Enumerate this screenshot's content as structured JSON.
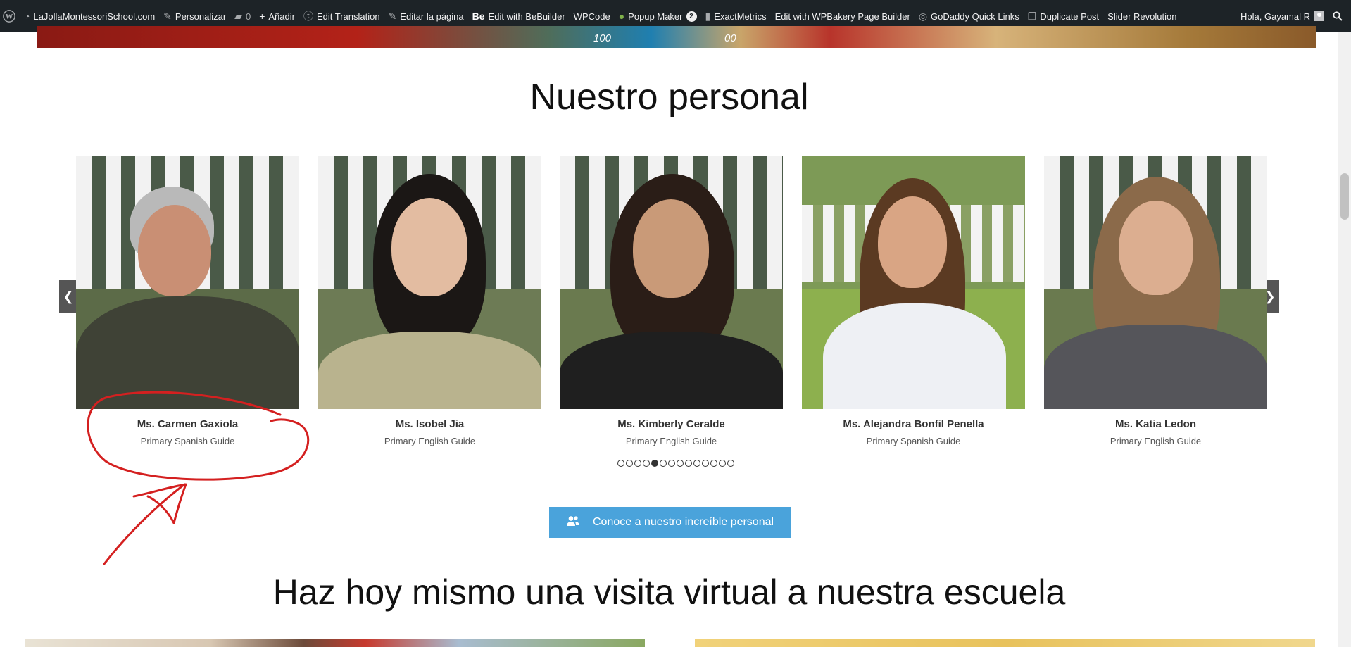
{
  "adminbar": {
    "site_name": "LaJollaMontessoriSchool.com",
    "items": [
      {
        "label": "Personalizar",
        "icon": "brush-icon"
      },
      {
        "label": "0",
        "icon": "comment-icon"
      },
      {
        "label": "Añadir",
        "icon": "plus-icon"
      },
      {
        "label": "Edit Translation",
        "icon": "translation-icon"
      },
      {
        "label": "Editar la página",
        "icon": "pencil-icon"
      },
      {
        "label": "Edit with BeBuilder",
        "icon": "be-icon"
      },
      {
        "label": "WPCode",
        "icon": ""
      },
      {
        "label": "Popup Maker",
        "icon": "popup-icon",
        "badge": "2"
      },
      {
        "label": "ExactMetrics",
        "icon": "bar-chart-icon"
      },
      {
        "label": "Edit with WPBakery Page Builder",
        "icon": ""
      },
      {
        "label": "GoDaddy Quick Links",
        "icon": "godaddy-icon"
      },
      {
        "label": "Duplicate Post",
        "icon": "copy-icon"
      },
      {
        "label": "Slider Revolution",
        "icon": ""
      }
    ],
    "greeting": "Hola, Gayamal R"
  },
  "hero": {
    "number_a": "100",
    "number_b": "00"
  },
  "section1": {
    "title": "Nuestro personal"
  },
  "staff": [
    {
      "name": "Ms. Carmen Gaxiola",
      "role": "Primary Spanish Guide"
    },
    {
      "name": "Ms. Isobel Jia",
      "role": "Primary English Guide"
    },
    {
      "name": "Ms. Kimberly Ceralde",
      "role": "Primary English Guide"
    },
    {
      "name": "Ms. Alejandra Bonfil Penella",
      "role": "Primary Spanish Guide"
    },
    {
      "name": "Ms. Katia Ledon",
      "role": "Primary English Guide"
    }
  ],
  "carousel": {
    "dot_count": 14,
    "active_index": 4,
    "prev_icon": "chevron-left-icon",
    "next_icon": "chevron-right-icon"
  },
  "cta": {
    "label": "Conoce a nuestro increíble personal",
    "icon": "users-icon",
    "color": "#4aa3db"
  },
  "section2": {
    "title": "Haz hoy mismo una visita virtual a nuestra escuela"
  },
  "colors": {
    "adminbar": "#1d2327",
    "annotation": "#d42020"
  }
}
